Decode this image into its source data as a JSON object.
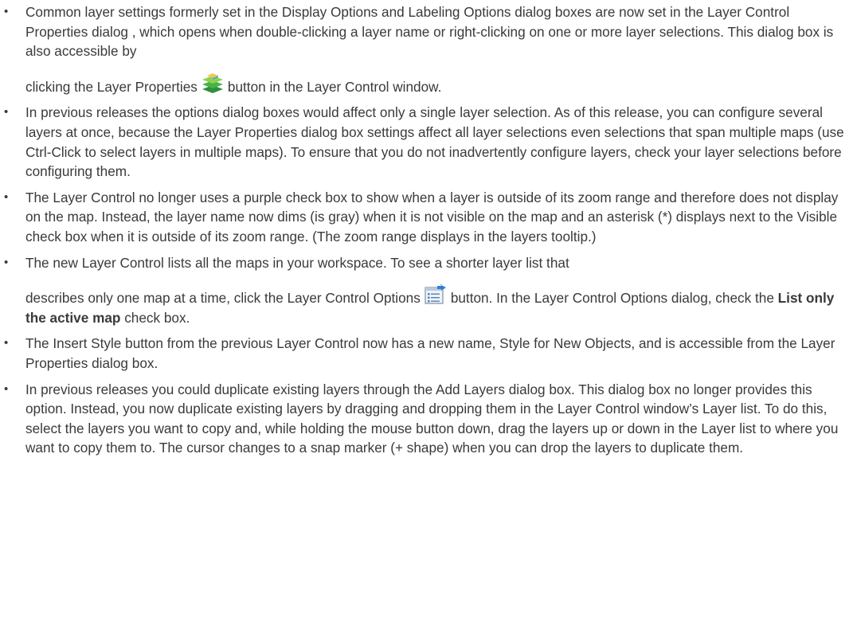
{
  "bullets": [
    {
      "text_a": "Common layer settings formerly set in the Display Options and Labeling Options dialog boxes are now set in the Layer Control Properties dialog , which opens when double-clicking a layer name or right-clicking on one or more layer selections. This dialog box is also accessible by",
      "text_b": "clicking the Layer Properties",
      "icon": "layer-properties-icon",
      "text_c": "button in the Layer Control window."
    },
    {
      "text": "In previous releases the options dialog boxes would affect only a single layer selection. As of this release, you can configure several layers at once, because the Layer Properties dialog box settings affect all layer selections even selections that span multiple maps (use Ctrl-Click to select layers in multiple maps). To ensure that you do not inadvertently configure layers, check your layer selections before configuring them."
    },
    {
      "text": "The Layer Control no longer uses a purple check box to show when a layer is outside of its zoom range and therefore does not display on the map. Instead, the layer name now dims (is gray) when it is not visible on the map and an asterisk (*) displays next to the Visible check box when it is outside of its zoom range. (The zoom range displays in the layers tooltip.)"
    },
    {
      "text_a": "The new Layer Control lists all the maps in your workspace. To see a shorter layer list that",
      "text_b": "describes only one map at a time, click the Layer Control Options",
      "icon": "layer-control-options-icon",
      "text_c": "button. In the Layer Control Options dialog, check the",
      "text_bold": "List only the active map",
      "text_d": "check box."
    },
    {
      "text": "The Insert Style button from the previous Layer Control now has a new name, Style for New Objects, and is accessible from the Layer Properties dialog box."
    },
    {
      "text": "In previous releases you could duplicate existing layers through the Add Layers dialog box. This dialog box no longer provides this option. Instead, you now duplicate existing layers by dragging and dropping them in the Layer Control window’s Layer list. To do this, select the layers you want to copy and, while holding the mouse button down, drag the layers up or down in the Layer list to where you want to copy them to. The cursor changes to a snap marker (+ shape) when you can drop the layers to duplicate them."
    }
  ],
  "bullet_glyph": "•"
}
